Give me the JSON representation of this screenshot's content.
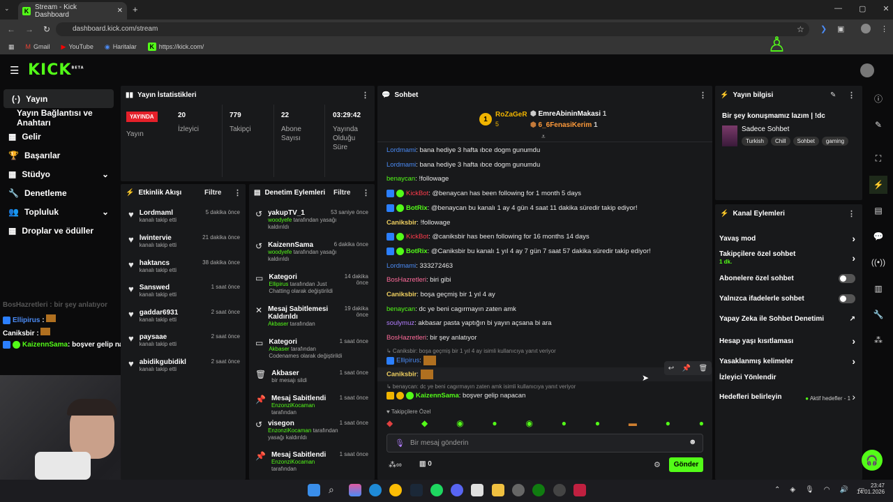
{
  "browser": {
    "tab_title": "Stream - Kick Dashboard",
    "url": "dashboard.kick.com/stream",
    "bookmarks": [
      "Gmail",
      "YouTube",
      "Haritalar",
      "https://kick.com/"
    ]
  },
  "logo": "KICK",
  "logo_sup": "BETA",
  "sidebar": {
    "items": [
      {
        "label": "Yayın",
        "icon": "(·)"
      },
      {
        "label": "Yayın Bağlantısı ve Anahtarı",
        "icon": ""
      },
      {
        "label": "Gelir",
        "icon": "▦"
      },
      {
        "label": "Başarılar",
        "icon": "🏆"
      },
      {
        "label": "Stüdyo",
        "icon": "▦"
      },
      {
        "label": "Denetleme",
        "icon": "🔧"
      },
      {
        "label": "Topluluk",
        "icon": "👥"
      },
      {
        "label": "Droplar ve ödüller",
        "icon": "▦"
      }
    ]
  },
  "stats": {
    "title": "Yayın İstatistikleri",
    "live_badge": "YAYINDA",
    "live_label": "Yayın",
    "items": [
      {
        "value": "20",
        "label": "İzleyici"
      },
      {
        "value": "779",
        "label": "Takipçi"
      },
      {
        "value": "22",
        "label": "Abone Sayısı"
      },
      {
        "value": "03:29:42",
        "label": "Yayında Olduğu Süre"
      }
    ]
  },
  "events": {
    "title": "Etkinlik Akışı",
    "filter": "Filtre",
    "items": [
      {
        "name": "Lordmaml",
        "sub": "kanalı takip etti",
        "time": "5 dakika önce"
      },
      {
        "name": "lwintervie",
        "sub": "kanalı takip etti",
        "time": "21 dakika önce"
      },
      {
        "name": "haktancs",
        "sub": "kanalı takip etti",
        "time": "38 dakika önce"
      },
      {
        "name": "Sanswed",
        "sub": "kanalı takip etti",
        "time": "1 saat önce"
      },
      {
        "name": "gaddar6931",
        "sub": "kanalı takip etti",
        "time": "2 saat önce"
      },
      {
        "name": "paysaae",
        "sub": "kanalı takip etti",
        "time": "2 saat önce"
      },
      {
        "name": "abidikgubidikl",
        "sub": "kanalı takip etti",
        "time": "2 saat önce"
      }
    ]
  },
  "moderation": {
    "title": "Denetim Eylemleri",
    "filter": "Filtre",
    "items": [
      {
        "icon": "↺",
        "name": "yakupTV_1",
        "who": "woodyefe",
        "rest": "tarafından yasağı kaldırıldı",
        "time": "53 saniye önce"
      },
      {
        "icon": "↺",
        "name": "KaizennSama",
        "who": "woodyefe",
        "rest": "tarafından yasağı kaldırıldı",
        "time": "6 dakika önce"
      },
      {
        "icon": "▭",
        "name": "Kategori",
        "who": "Ellipirus",
        "rest": "tarafından Just Chatting olarak değiştirildi",
        "time": "14 dakika önce"
      },
      {
        "icon": "✕",
        "name": "Mesaj Sabitlemesi Kaldırıldı",
        "who": "Akbaser",
        "rest": "tarafından",
        "time": "19 dakika önce"
      },
      {
        "icon": "▭",
        "name": "Kategori",
        "who": "Akbaser",
        "rest": "tarafından Codenames olarak değiştirildi",
        "time": "1 saat önce"
      },
      {
        "icon": "🗑",
        "name": "Akbaser",
        "who": "",
        "rest": "bir mesajı sildi",
        "time": "1 saat önce"
      },
      {
        "icon": "📌",
        "name": "Mesaj Sabitlendi",
        "who": "EnzonziKocaman",
        "rest": "tarafından",
        "time": "1 saat önce"
      },
      {
        "icon": "↺",
        "name": "visegon",
        "who": "EnzonziKocaman",
        "rest": "tarafından yasağı kaldırıldı",
        "time": "1 saat önce"
      },
      {
        "icon": "📌",
        "name": "Mesaj Sabitlendi",
        "who": "EnzonziKocaman",
        "rest": "tarafından",
        "time": "1 saat önce"
      }
    ]
  },
  "chat": {
    "title": "Sohbet",
    "top": [
      {
        "name": "RoZaGeR",
        "count": "5"
      },
      {
        "name": "EmreAbininMakasi",
        "count": "1"
      },
      {
        "name": "6_6FenasiKerim",
        "count": "1"
      }
    ],
    "messages": [
      {
        "user": "Lordmami",
        "cls": "u-blue",
        "text": ": bana hediye 3 hafta ıbce dogm gunumdu"
      },
      {
        "user": "Lordmami",
        "cls": "u-blue",
        "text": ": bana hediye 3 hafta ıbce dogm gunumdu"
      },
      {
        "user": "benaycan",
        "cls": "u-green",
        "text": ": !followage"
      },
      {
        "user": "KickBot",
        "cls": "u-red",
        "text": ": @benaycan has been following for 1 month 5 days"
      },
      {
        "user": "BotRix",
        "cls": "u-green",
        "text": ": @benaycan bu kanalı 1 ay 4 gün 4 saat 11 dakika süredir takip ediyor!"
      },
      {
        "user": "Caniksbir",
        "cls": "u-yellow",
        "text": ": !followage"
      },
      {
        "user": "KickBot",
        "cls": "u-red",
        "text": ": @caniksbir has been following for 16 months 14 days"
      },
      {
        "user": "BotRix",
        "cls": "u-green",
        "text": ": @Caniksbir bu kanalı 1 yıl 4 ay 7 gün 7 saat 57 dakika süredir takip ediyor!"
      },
      {
        "user": "Lordmami",
        "cls": "u-blue",
        "text": ": 333272463"
      },
      {
        "user": "BosHazretleri",
        "cls": "u-pink",
        "text": ": biri gibi"
      },
      {
        "user": "Caniksbir",
        "cls": "u-yellow",
        "text": ": boşa geçmiş bir 1 yıl 4 ay"
      },
      {
        "user": "benaycan",
        "cls": "u-green",
        "text": ": dc ye beni cagırmayın zaten amk"
      },
      {
        "user": "soulymuz",
        "cls": "u-purple",
        "text": ": akbasar pasta yaptığın bi yayın açsana bi ara"
      },
      {
        "user": "BosHazretleri",
        "cls": "u-pink",
        "text": ": bir şey anlatıyor"
      }
    ],
    "reply1": "↳ Caniksbir: boşa geçmiş bir 1 yıl 4 ay isimli kullanıcıya yanıt veriyor",
    "ellipirus": "Ellipirus",
    "caniksbir": "Caniksbir",
    "reply2": "↳ benaycan: dc ye beni cagırmayın zaten amk isimli kullanıcıya yanıt veriyor",
    "last_user": "KaizennSama",
    "last_text": ": boşver gelip napacan",
    "followers_only": "Takipçilere Özel",
    "input_placeholder": "Bir mesaj gönderin",
    "send": "Gönder",
    "points": "0"
  },
  "info": {
    "title": "Yayın bilgisi",
    "stream_title": "Bir şey konuşmamız lazım | !dc",
    "category": "Sadece Sohbet",
    "tags": [
      "Turkish",
      "Chill",
      "Sohbet",
      "gaming"
    ]
  },
  "channel": {
    "title": "Kanal Eylemleri",
    "items": [
      {
        "label": "Yavaş mod",
        "kind": "chev"
      },
      {
        "label": "Takipçilere özel sohbet",
        "sub": "1 dk.",
        "kind": "chev"
      },
      {
        "label": "Abonelere özel sohbet",
        "kind": "toggle"
      },
      {
        "label": "Yalnızca ifadelerle sohbet",
        "kind": "toggle"
      },
      {
        "label": "Yapay Zeka ile Sohbet Denetimi",
        "kind": "ext"
      },
      {
        "label": "Hesap yaşı kısıtlaması",
        "kind": "chev"
      },
      {
        "label": "Yasaklanmış kelimeler",
        "kind": "chev"
      },
      {
        "label": "İzleyici Yönlendir",
        "kind": "none"
      },
      {
        "label": "Hedefleri belirleyin",
        "kind": "goal",
        "extra": "Aktif hedefler - 1"
      }
    ]
  },
  "overlay": {
    "faded": "BosHazretleri : bir şey anlatıyor",
    "l1u": "Ellipirus",
    "l2u": "Caniksbir",
    "l3u": "KaizennSama",
    "l3t": ": boşver gelip napacan"
  },
  "taskbar": {
    "time": "23:47",
    "date": "14.01.2026"
  },
  "colors": {
    "accent": "#53fc18",
    "panel": "#18191b",
    "bg": "#0b0b0c"
  }
}
